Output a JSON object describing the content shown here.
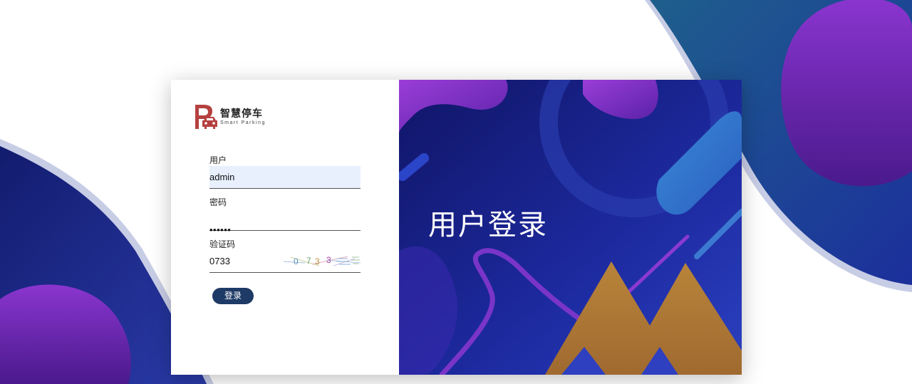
{
  "brand": {
    "name_cn": "智慧停车",
    "name_en": "Smart Parking",
    "logo_letter": "P",
    "logo_color": "#b5413f"
  },
  "form": {
    "username": {
      "label": "用户",
      "value": "admin"
    },
    "password": {
      "label": "密码",
      "masked_value": "••••••"
    },
    "captcha": {
      "label": "验证码",
      "value": "0733",
      "image_text": "0733"
    },
    "submit_label": "登录"
  },
  "hero": {
    "title": "用户登录"
  },
  "colors": {
    "button": "#1e3a66",
    "hero_deep_blue": "#1a1f8c",
    "accent_purple": "#7b2fc9",
    "accent_gold": "#b8843a"
  }
}
